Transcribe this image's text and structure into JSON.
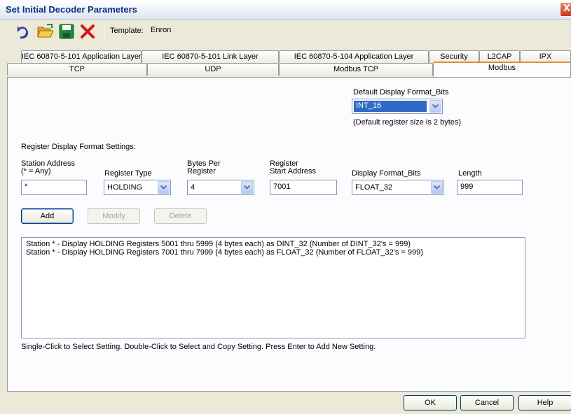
{
  "window": {
    "title": "Set Initial Decoder Parameters",
    "close_glyph": "X"
  },
  "toolbar": {
    "template_label": "Template:",
    "template_value": "Enron",
    "icons": [
      "undo-icon",
      "open-folder-icon",
      "save-icon",
      "delete-icon"
    ]
  },
  "tabs": {
    "row1": [
      {
        "label": "IEC 60870-5-101 Application Layer"
      },
      {
        "label": "IEC 60870-5-101 Link Layer"
      },
      {
        "label": "IEC 60870-5-104 Application Layer"
      },
      {
        "label": "Security"
      },
      {
        "label": "L2CAP"
      },
      {
        "label": "IPX"
      }
    ],
    "row2": [
      {
        "label": "TCP"
      },
      {
        "label": "UDP"
      },
      {
        "label": "Modbus TCP"
      },
      {
        "label": "Modbus",
        "active": true
      }
    ]
  },
  "modbus": {
    "default_format": {
      "label": "Default Display Format_Bits",
      "value": "INT_16",
      "note": "(Default register size is 2 bytes)"
    },
    "register_settings_heading": "Register Display Format Settings:",
    "columns": {
      "station_address_line1": "Station Address",
      "station_address_line2": "(* = Any)",
      "register_type": "Register Type",
      "bytes_per_register_line1": "Bytes Per",
      "bytes_per_register_line2": "Register",
      "register_start_line1": "Register",
      "register_start_line2": "Start Address",
      "display_format": "Display Format_Bits",
      "length": "Length"
    },
    "inputs": {
      "station_address": "*",
      "register_type": "HOLDING",
      "bytes_per_register": "4",
      "register_start_address": "7001",
      "display_format": "FLOAT_32",
      "length": "999"
    },
    "buttons": {
      "add": "Add",
      "modify": "Modify",
      "delete": "Delete"
    },
    "settings_list": [
      "Station * - Display HOLDING Registers 5001 thru 5999 (4 bytes each) as DINT_32 (Number of DINT_32's = 999)",
      "Station * - Display HOLDING Registers 7001 thru 7999 (4 bytes each) as FLOAT_32 (Number of FLOAT_32's = 999)"
    ],
    "hint": "Single-Click to Select Setting.  Double-Click to Select and Copy Setting.  Press Enter to Add New Setting."
  },
  "dialog_buttons": {
    "ok": "OK",
    "cancel": "Cancel",
    "help": "Help"
  },
  "colors": {
    "title_text": "#0c2f80",
    "active_tab_accent": "#e68b2c",
    "selection": "#316ac5",
    "delete_red": "#d11a1a",
    "save_green": "#1f8a3a"
  }
}
